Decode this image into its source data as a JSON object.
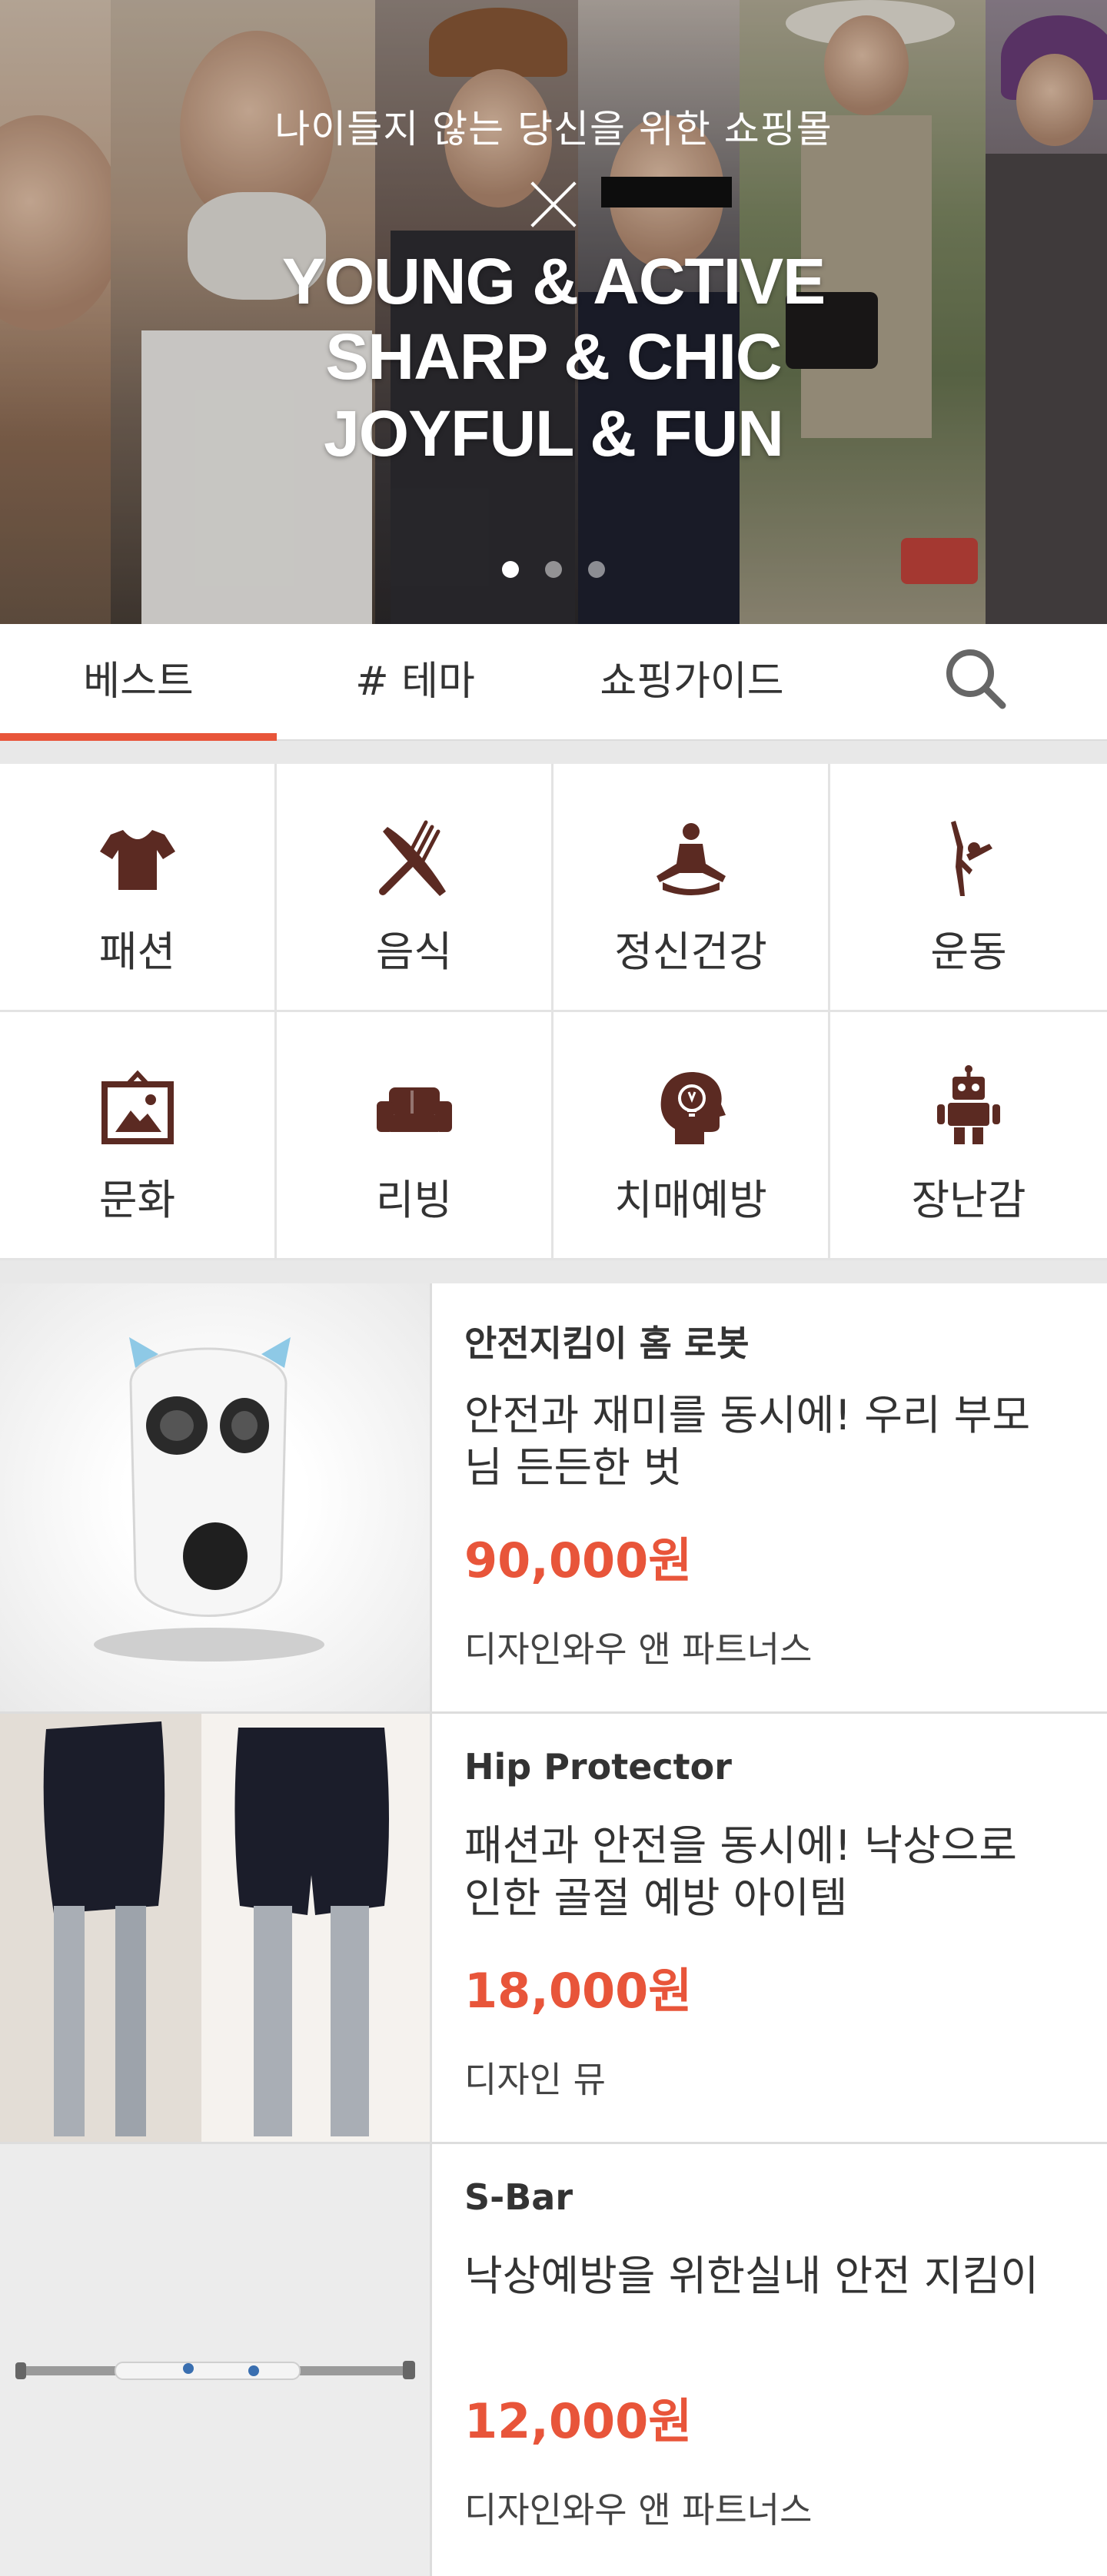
{
  "hero": {
    "tagline": "나이들지 않는 당신을 위한 쇼핑몰",
    "lines": [
      "YOUNG & ACTIVE",
      "SHARP & CHIC",
      "JOYFUL & FUN"
    ],
    "slide_count": 3,
    "active_slide": 1
  },
  "tabs": [
    {
      "label": "베스트",
      "active": true
    },
    {
      "label": "# 테마",
      "active": false
    },
    {
      "label": "쇼핑가이드",
      "active": false
    }
  ],
  "search": {
    "icon": "search-icon"
  },
  "categories": [
    {
      "label": "패션",
      "icon": "tshirt-icon"
    },
    {
      "label": "음식",
      "icon": "fork-knife-icon"
    },
    {
      "label": "정신건강",
      "icon": "meditation-icon"
    },
    {
      "label": "운동",
      "icon": "dancer-icon"
    },
    {
      "label": "문화",
      "icon": "picture-frame-icon"
    },
    {
      "label": "리빙",
      "icon": "sofa-icon"
    },
    {
      "label": "치매예방",
      "icon": "brain-head-icon"
    },
    {
      "label": "장난감",
      "icon": "robot-icon"
    }
  ],
  "products": [
    {
      "name": "안전지킴이 홈 로봇",
      "description": "안전과 재미를 동시에! 우리 부모님 든든한 벗",
      "price": "90,000원",
      "seller": "디자인와우 앤 파트너스"
    },
    {
      "name": "Hip Protector",
      "description": "패션과 안전을 동시에! 낙상으로 인한 골절 예방 아이템",
      "price": "18,000원",
      "seller": "디자인 뮤"
    },
    {
      "name": "S-Bar",
      "description": "낙상예방을 위한실내 안전 지킴이",
      "price": "12,000원",
      "seller": "디자인와우 앤 파트너스"
    }
  ],
  "colors": {
    "accent": "#e8553a",
    "icon": "#5b2a22",
    "divider": "#dddddd"
  }
}
